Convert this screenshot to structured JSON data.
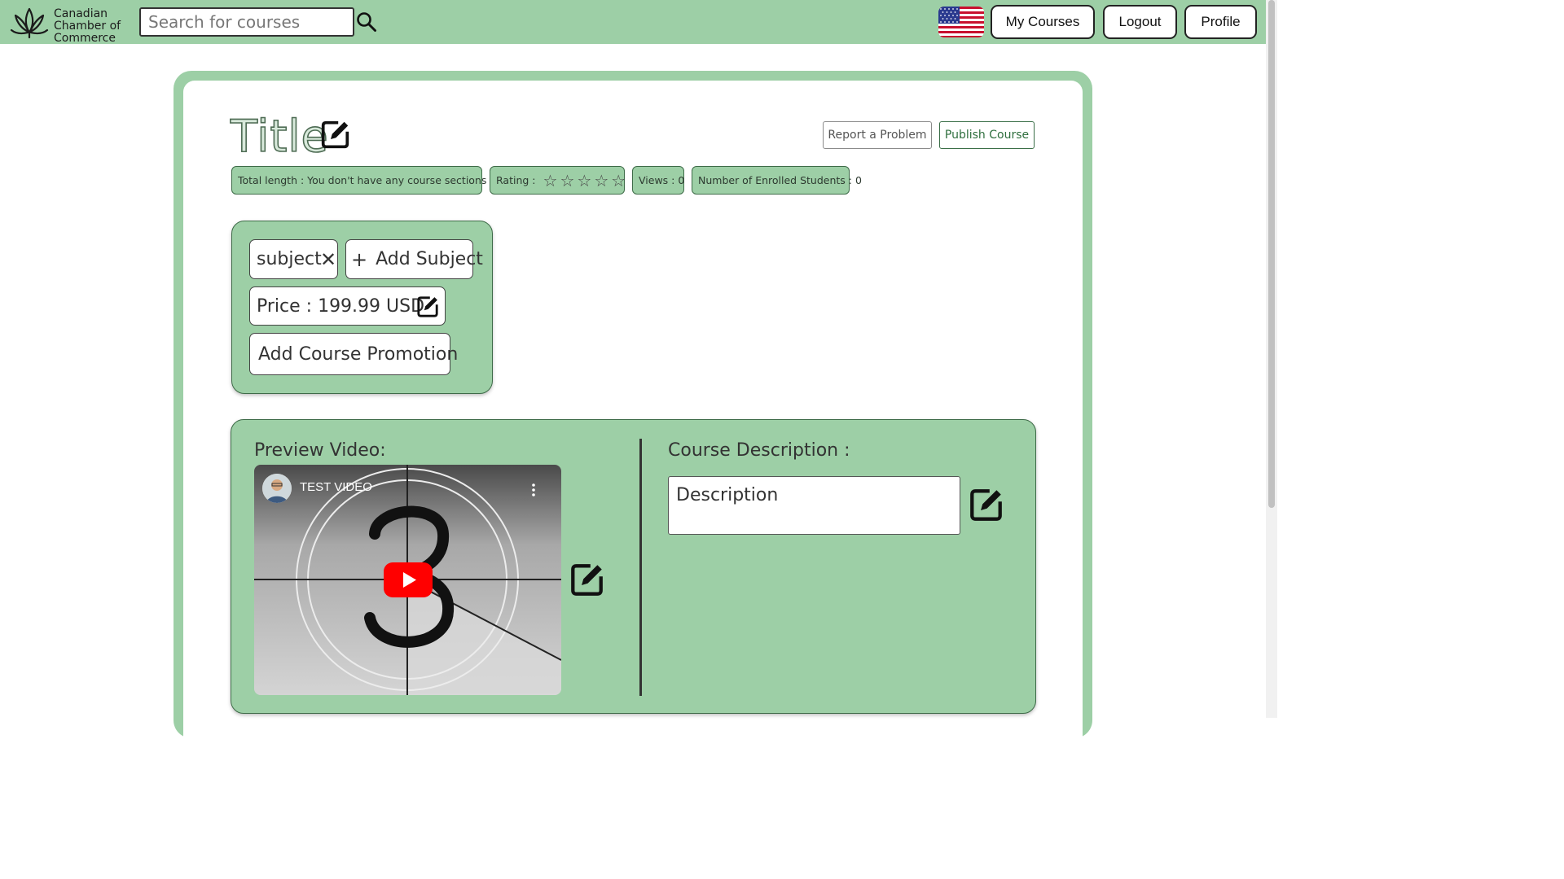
{
  "brand": {
    "lines": [
      "Canadian",
      "Chamber of",
      "Commerce"
    ]
  },
  "search": {
    "placeholder": "Search for courses"
  },
  "nav": {
    "my_courses": "My Courses",
    "logout": "Logout",
    "profile": "Profile",
    "language_flag": "us-flag-icon"
  },
  "course": {
    "title": "Title",
    "report_label": "Report a Problem",
    "publish_label": "Publish Course",
    "stats": {
      "total_length": "Total length : You don't have any course sections yet.",
      "rating_label": "Rating :",
      "rating_value": 0,
      "rating_max": 5,
      "views": "Views : 0",
      "enrolled": "Number of Enrolled Students : 0"
    },
    "subject_chip": "subject",
    "add_subject": "Add Subject",
    "price": "Price : 199.99 USD",
    "add_promotion": "Add Course Promotion",
    "preview_label": "Preview Video:",
    "video_title": "TEST VIDEO",
    "description_label": "Course Description :",
    "description_value": "Description"
  },
  "colors": {
    "accent_green": "#9dcfa6",
    "border_green": "#3e6b48",
    "youtube_red": "#ff0000"
  }
}
